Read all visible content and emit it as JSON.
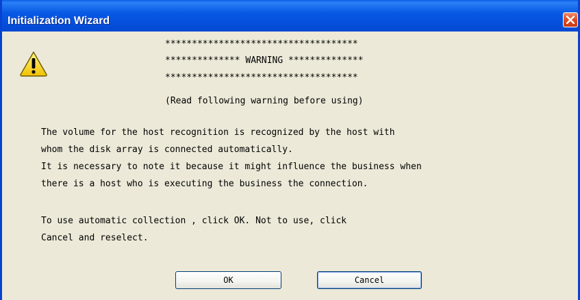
{
  "window": {
    "title": "Initialization Wizard",
    "close_icon": "close-x-icon"
  },
  "header": {
    "icon": "warning-triangle-icon",
    "stars_line": "************************************",
    "warning_line": "************** WARNING **************",
    "note": "(Read following warning before using)"
  },
  "message": {
    "lines": [
      "The volume for the host recognition is recognized by the host with",
      "whom the disk array is connected automatically.",
      "It is necessary to note it because it might influence the business when",
      "there is a host who is executing the business the connection.",
      "To use automatic collection , click OK. Not to use, click",
      "Cancel and reselect."
    ]
  },
  "buttons": {
    "ok_label": "OK",
    "cancel_label": "Cancel"
  },
  "colors": {
    "title_bar": "#0550dc",
    "dialog_bg": "#ece9d8",
    "close_button": "#dc4b22",
    "warning_yellow": "#ffd800"
  }
}
